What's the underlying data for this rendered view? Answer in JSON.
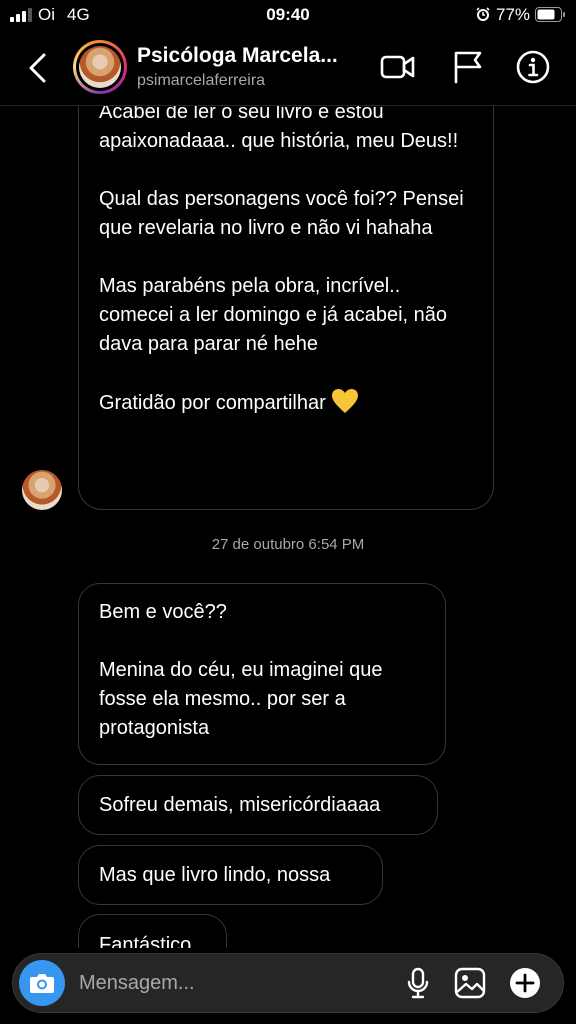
{
  "status_bar": {
    "carrier": "Oi",
    "network": "4G",
    "time": "09:40",
    "battery": "77%"
  },
  "header": {
    "name": "Psicóloga Marcela...",
    "username": "psimarcelaferreira",
    "icons": [
      "back-chevron-icon",
      "video-call-icon",
      "flag-icon",
      "info-icon"
    ]
  },
  "messages": {
    "m1": {
      "p1": "Acabei de ler o seu livro e estou apaixonadaaa.. que história, meu Deus!!",
      "p2": "Qual das personagens você foi?? Pensei que revelaria no livro e não vi hahaha",
      "p3": "Mas parabéns pela obra, incrível.. comecei a ler domingo e já acabei, não dava para parar né hehe",
      "p4": "Gratidão por compartilhar"
    },
    "timestamp": "27 de outubro 6:54 PM",
    "m2": {
      "p1": "Bem e você??",
      "p2": "Menina do céu, eu imaginei que fosse ela mesmo.. por ser a protagonista"
    },
    "m3": "Sofreu demais, misericórdiaaaa",
    "m4": "Mas que livro lindo, nossa",
    "m5": "Fantástico"
  },
  "composer": {
    "placeholder": "Mensagem..."
  },
  "colors": {
    "background": "#000000",
    "bubble_border": "#363636",
    "composer_bg": "#262626",
    "camera_blue": "#3797f0",
    "heart_yellow": "#f8c537",
    "muted_text": "#a8a8a8"
  }
}
